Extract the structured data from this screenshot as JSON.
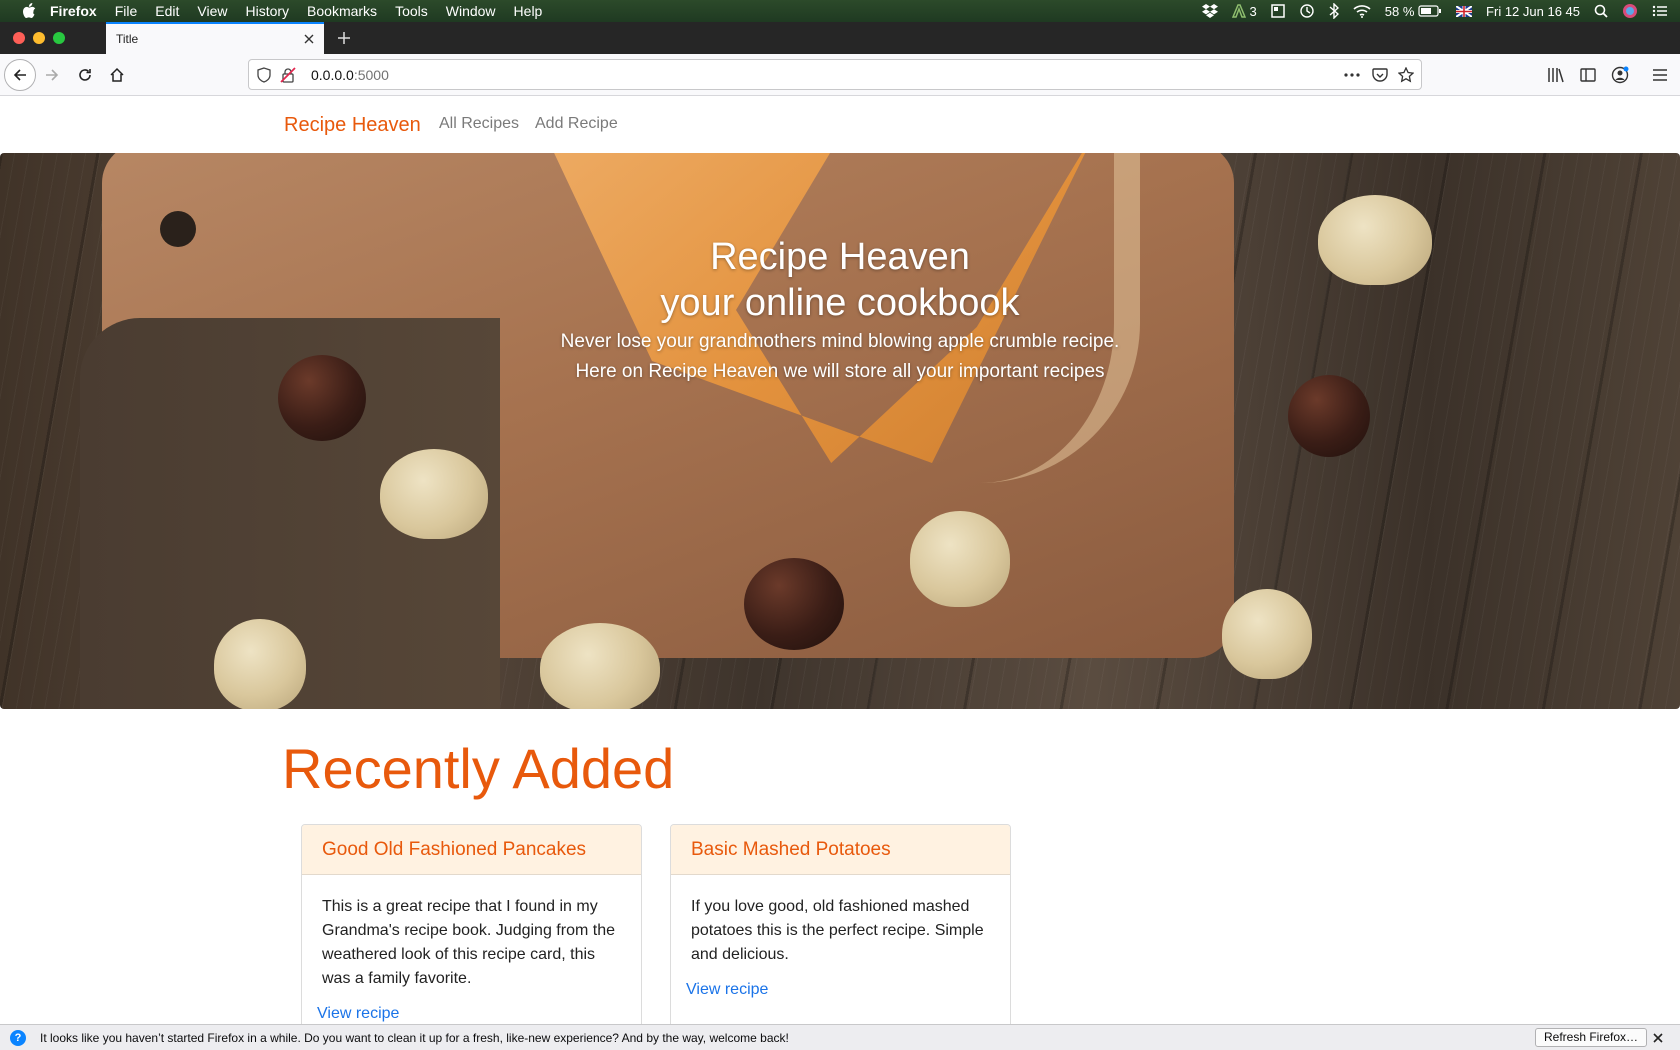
{
  "menubar": {
    "app": "Firefox",
    "items": [
      "File",
      "Edit",
      "View",
      "History",
      "Bookmarks",
      "Tools",
      "Window",
      "Help"
    ],
    "status": {
      "badge_count": "3",
      "battery": "58 %",
      "datetime": "Fri 12 Jun  16 45"
    }
  },
  "browser": {
    "tab_title": "Title",
    "url_host": "0.0.0.0",
    "url_port": ":5000"
  },
  "site": {
    "brand": "Recipe Heaven",
    "nav": [
      "All Recipes",
      "Add Recipe"
    ]
  },
  "hero": {
    "title_line1": "Recipe Heaven",
    "title_line2": "your online cookbook",
    "sub_line1": "Never lose your grandmothers mind blowing apple crumble recipe.",
    "sub_line2": "Here on Recipe Heaven we will store all your important recipes"
  },
  "recent": {
    "heading": "Recently Added",
    "cards": [
      {
        "title": "Good Old Fashioned Pancakes",
        "description": "This is a great recipe that I found in my Grandma's recipe book. Judging from the weathered look of this recipe card, this was a family favorite.",
        "link": "View recipe"
      },
      {
        "title": "Basic Mashed Potatoes",
        "description": "If you love good, old fashioned mashed potatoes this is the perfect recipe. Simple and delicious.",
        "link": "View recipe"
      }
    ]
  },
  "notification": {
    "message": "It looks like you haven’t started Firefox in a while. Do you want to clean it up for a fresh, like-new experience? And by the way, welcome back!",
    "button": "Refresh Firefox…"
  },
  "colors": {
    "accent": "#e8590c",
    "link": "#1a73e8",
    "card_header": "#fff2e1"
  }
}
